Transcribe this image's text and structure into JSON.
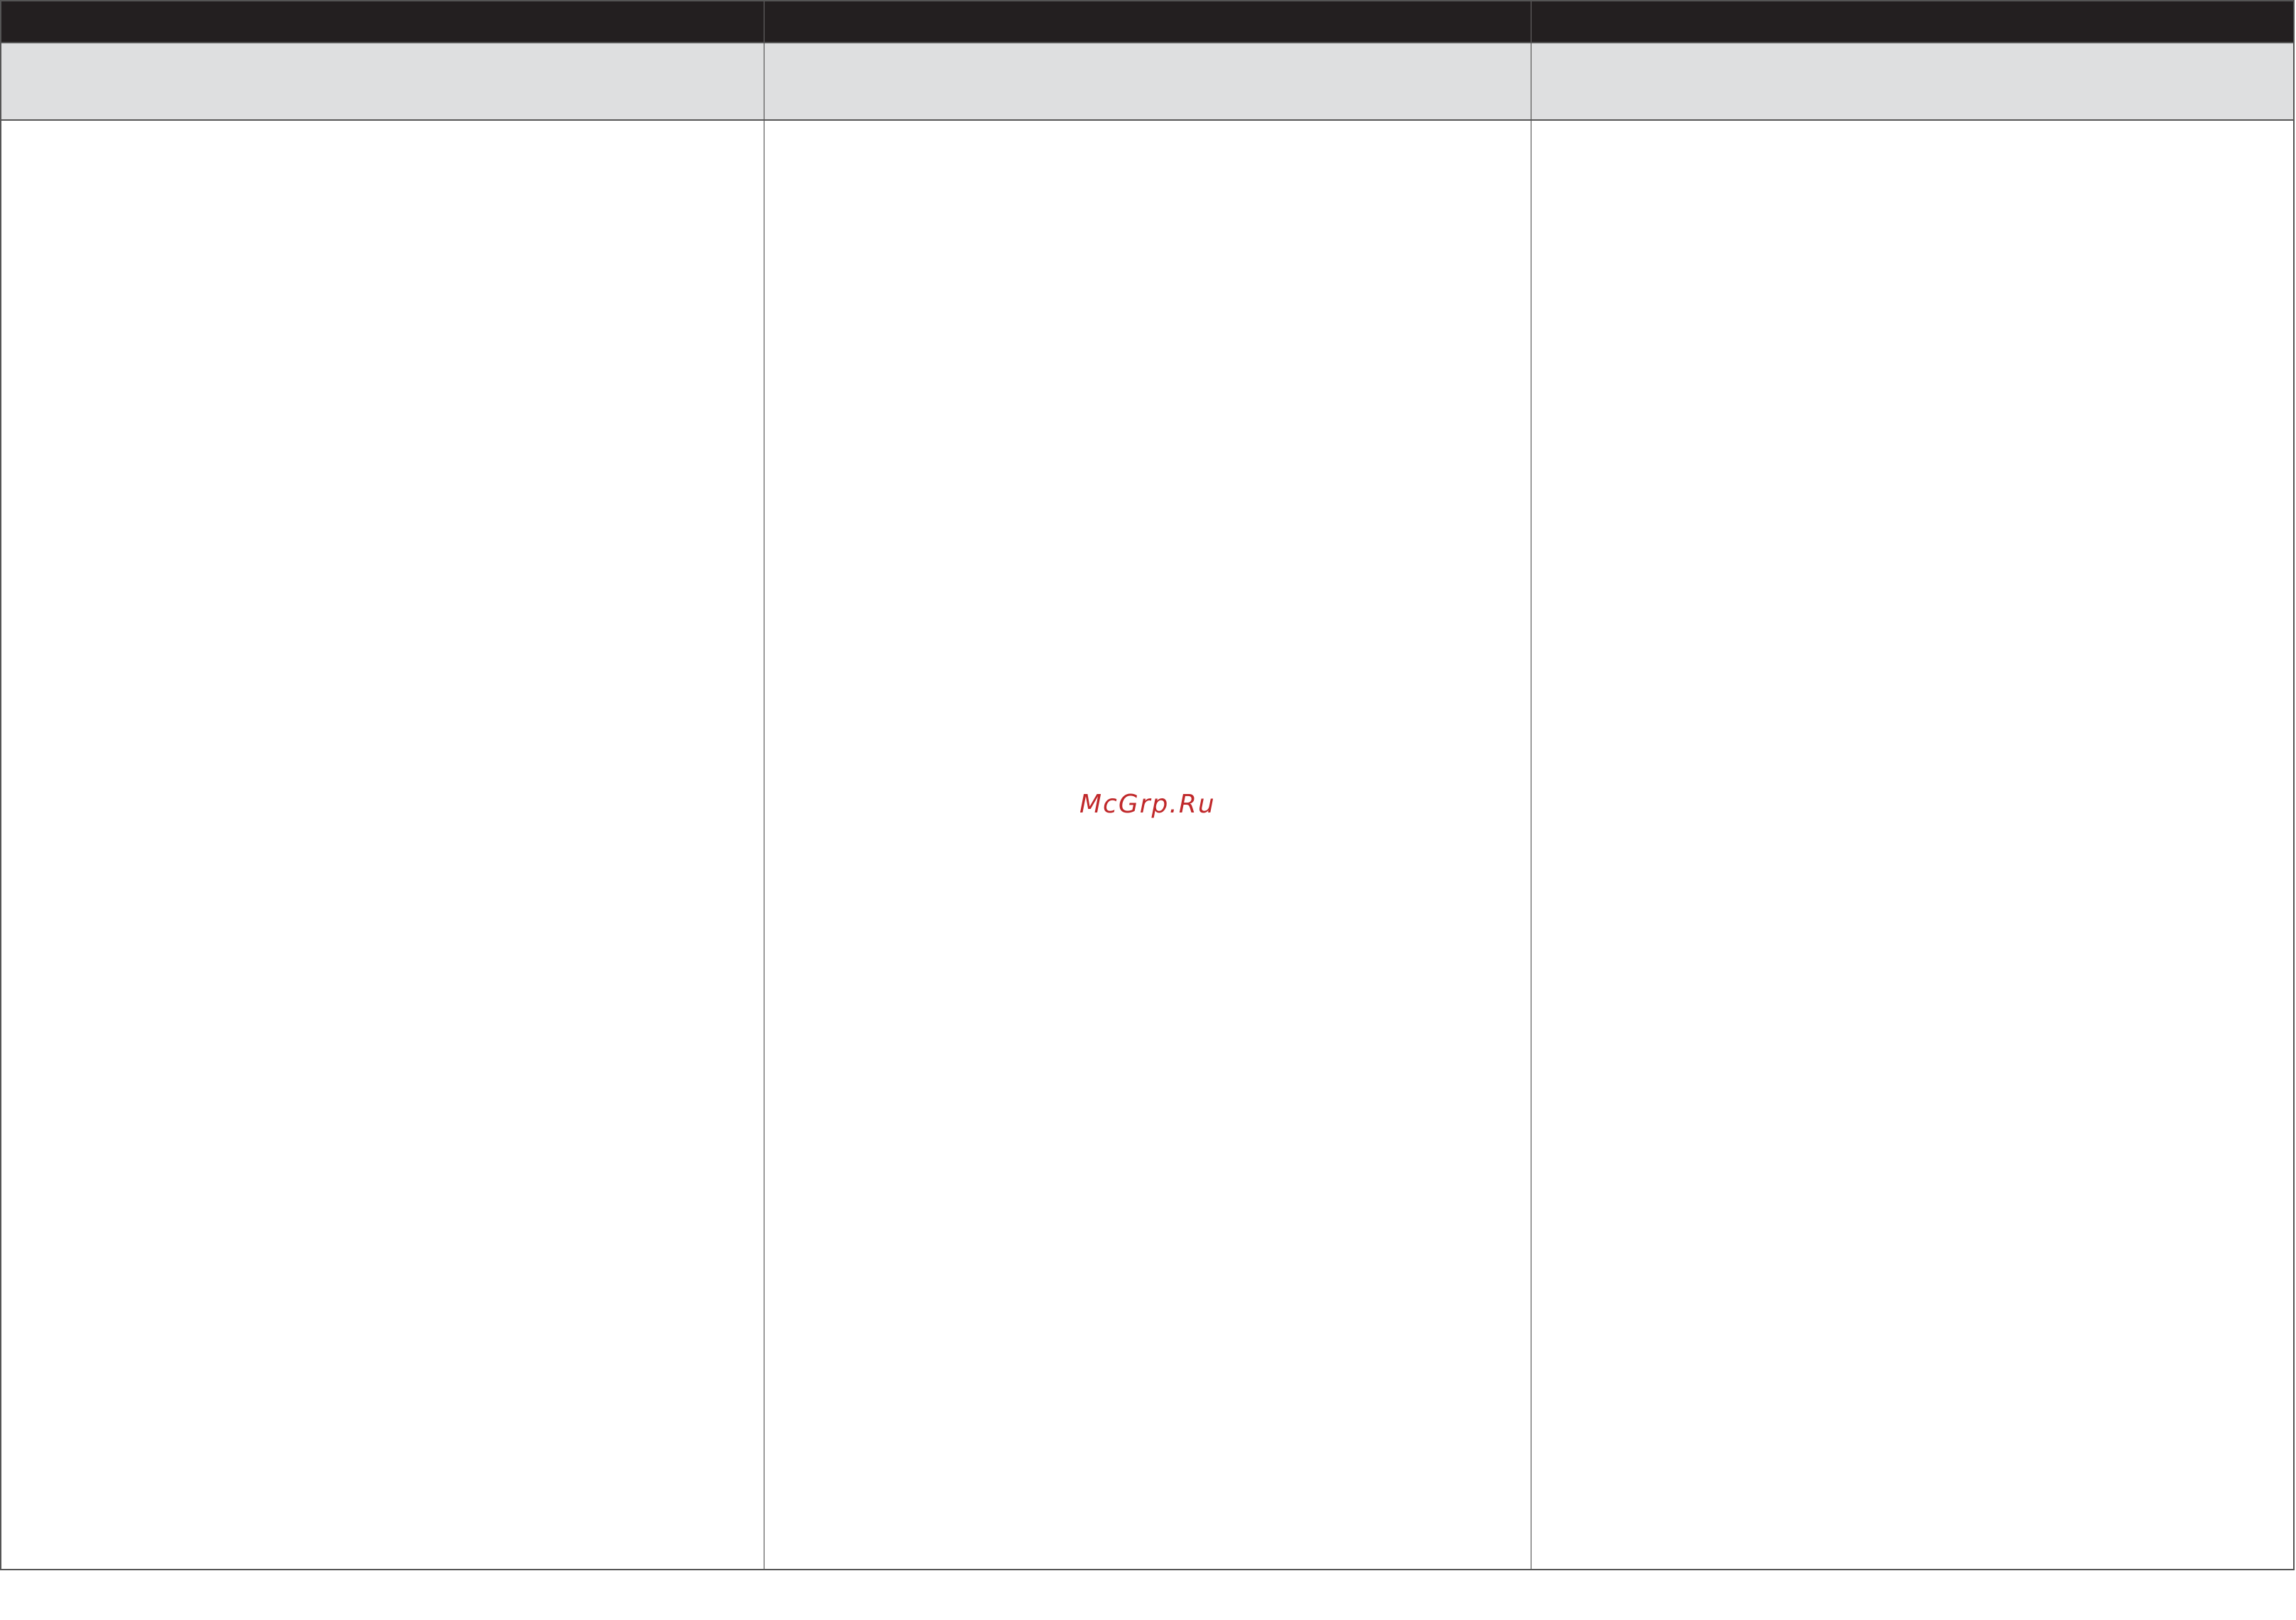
{
  "watermark": {
    "text": "McGrp.Ru",
    "color": "#c0282a"
  },
  "colors": {
    "header_band": "#231f20",
    "subheader_band": "#dedfe0",
    "border": "#555555",
    "body": "#ffffff"
  },
  "table": {
    "columns": [
      {
        "header": "",
        "subheader": "",
        "body": ""
      },
      {
        "header": "",
        "subheader": "",
        "body": ""
      },
      {
        "header": "",
        "subheader": "",
        "body": ""
      }
    ]
  }
}
